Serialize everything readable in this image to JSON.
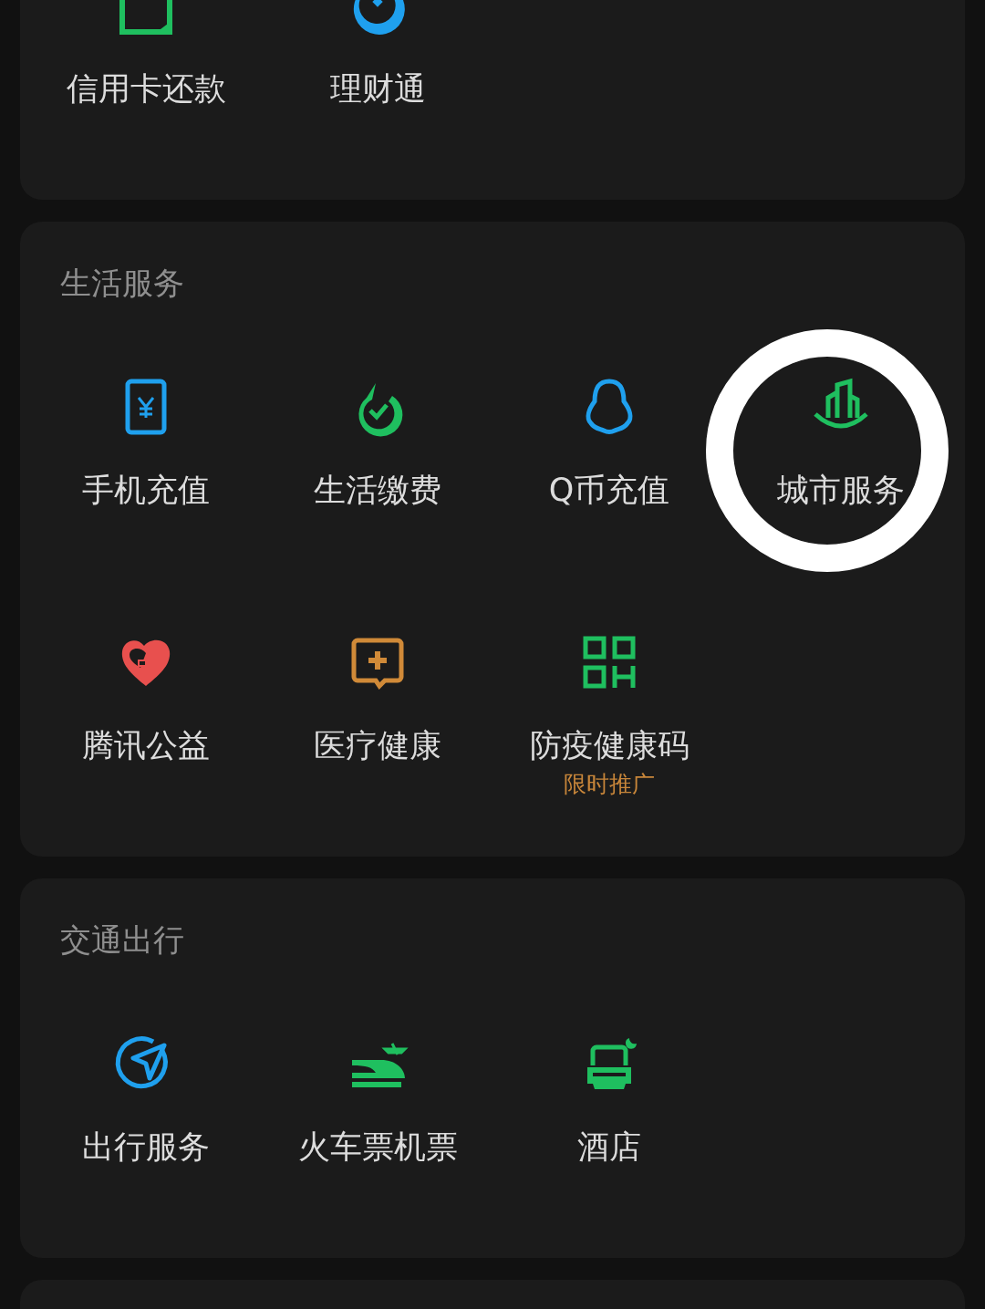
{
  "sections": [
    {
      "items": [
        {
          "label": "信用卡还款",
          "highlighted": false
        },
        {
          "label": "理财通",
          "highlighted": false
        }
      ]
    },
    {
      "title": "生活服务",
      "items": [
        {
          "label": "手机充值",
          "highlighted": false
        },
        {
          "label": "生活缴费",
          "highlighted": false
        },
        {
          "label": "Q币充值",
          "highlighted": false
        },
        {
          "label": "城市服务",
          "highlighted": true
        },
        {
          "label": "腾讯公益",
          "highlighted": false
        },
        {
          "label": "医疗健康",
          "highlighted": false
        },
        {
          "label": "防疫健康码",
          "sublabel": "限时推广",
          "highlighted": false
        }
      ]
    },
    {
      "title": "交通出行",
      "items": [
        {
          "label": "出行服务",
          "highlighted": false
        },
        {
          "label": "火车票机票",
          "highlighted": false
        },
        {
          "label": "酒店",
          "highlighted": false
        }
      ]
    }
  ]
}
